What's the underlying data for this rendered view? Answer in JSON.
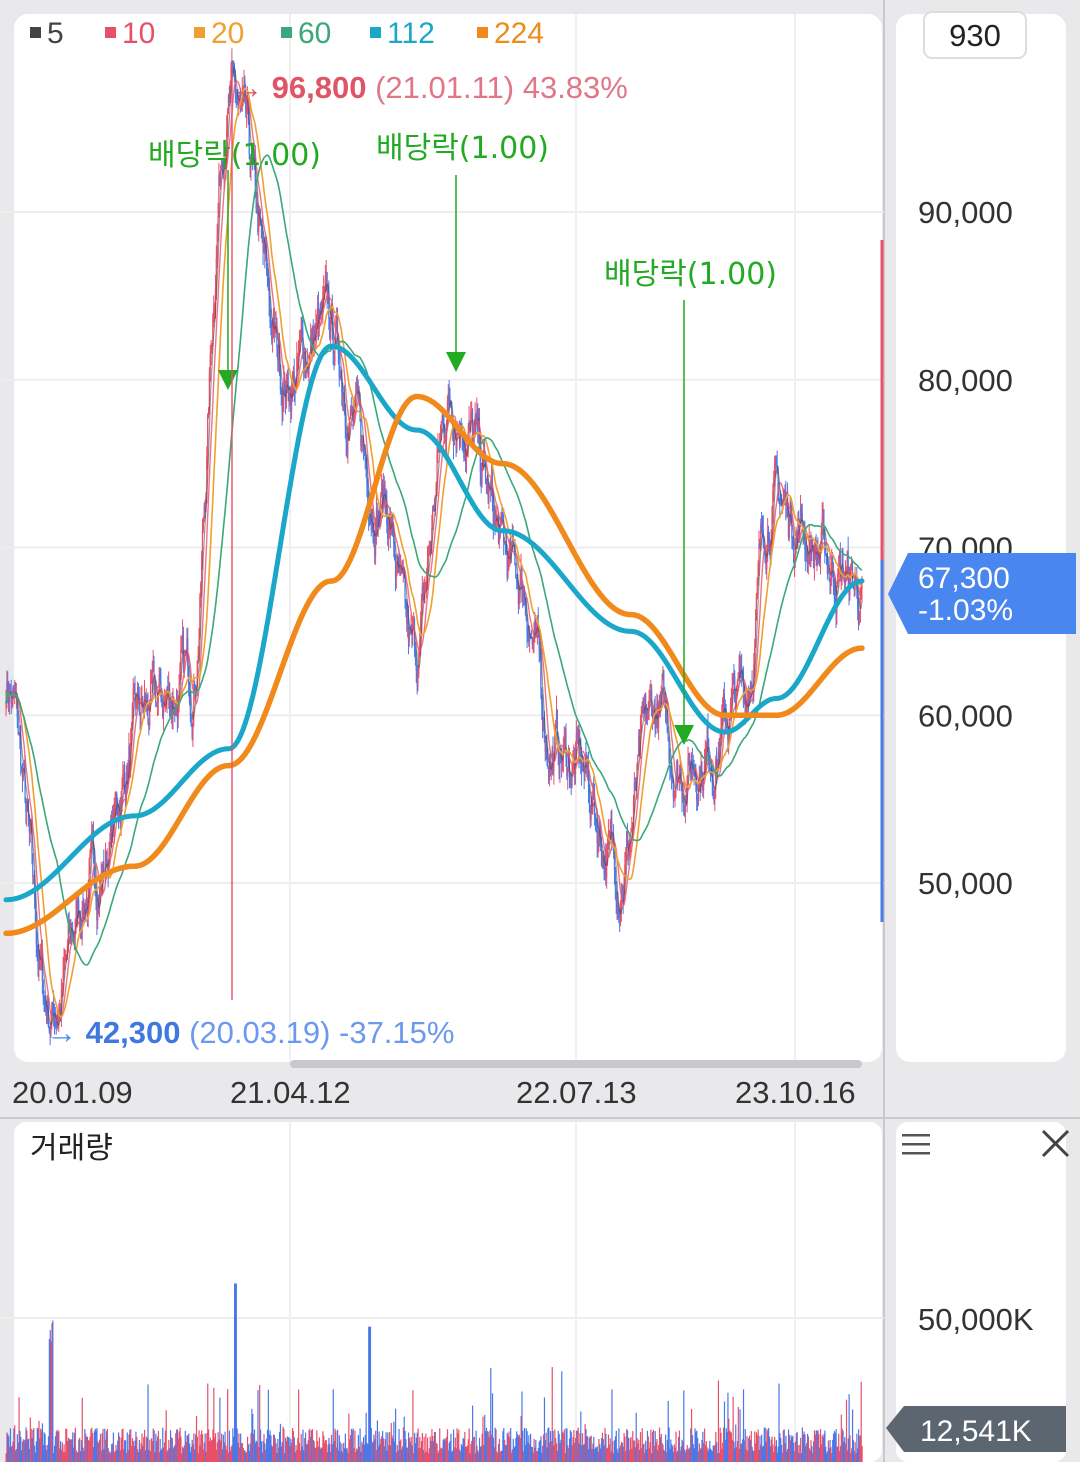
{
  "header": {
    "count_badge": "930"
  },
  "legend": [
    {
      "label": "5",
      "color": "#444444"
    },
    {
      "label": "10",
      "color": "#e8506a"
    },
    {
      "label": "20",
      "color": "#f0a030"
    },
    {
      "label": "60",
      "color": "#3aa87a"
    },
    {
      "label": "112",
      "color": "#1aa7c9"
    },
    {
      "label": "224",
      "color": "#f08a1c"
    }
  ],
  "annotations": {
    "high": {
      "arrow": "→",
      "value": "96,800",
      "detail": "(21.01.11) 43.83%"
    },
    "low": {
      "arrow": "→",
      "value": "42,300",
      "detail": "(20.03.19) -37.15%"
    },
    "dividends": [
      "배당락(1.00)",
      "배당락(1.00)",
      "배당락(1.00)"
    ]
  },
  "price_tag": {
    "price": "67,300",
    "change": "-1.03%"
  },
  "volume_panel": {
    "title": "거래량",
    "menu_icon": "hamburger-icon",
    "close_icon": "close-icon",
    "axis_label": "50,000K",
    "current_tag": "12,541K"
  },
  "colors": {
    "candle_down": "#4a78e8",
    "candle_up": "#e8506a",
    "dividend": "#22aa22",
    "price_tag": "#4a86f0"
  },
  "chart_data": {
    "type": "line",
    "y_ticks": [
      "90,000",
      "80,000",
      "70,000",
      "60,000",
      "50,000"
    ],
    "y_tick_values": [
      90000,
      80000,
      70000,
      60000,
      50000
    ],
    "ylim": [
      38000,
      100000
    ],
    "x_ticks": [
      "20.01.09",
      "21.04.12",
      "22.07.13",
      "23.10.16"
    ],
    "series": [
      {
        "name": "price",
        "x": [
          "20.01.09",
          "20.03.19",
          "20.06",
          "20.09",
          "20.11",
          "21.01.11",
          "21.04.12",
          "21.06",
          "21.09",
          "21.11",
          "22.01",
          "22.03",
          "22.05",
          "22.07.13",
          "22.09",
          "22.11",
          "23.01",
          "23.03",
          "23.05",
          "23.07",
          "23.10.16",
          "23.12",
          "24.02"
        ],
        "values": [
          62000,
          42300,
          50000,
          60000,
          62000,
          96800,
          80000,
          83000,
          73000,
          63000,
          79000,
          68000,
          58000,
          57000,
          51000,
          60000,
          57000,
          58000,
          61000,
          73000,
          72000,
          69000,
          67300
        ]
      },
      {
        "name": "112",
        "x": [
          "20.01.09",
          "20.06",
          "20.11",
          "21.04.12",
          "21.09",
          "22.01",
          "22.07.13",
          "23.01",
          "23.06",
          "24.02"
        ],
        "values": [
          49000,
          54000,
          58000,
          82000,
          77000,
          71000,
          65000,
          59000,
          61000,
          68000
        ]
      },
      {
        "name": "224",
        "x": [
          "20.01.09",
          "20.06",
          "20.11",
          "21.04.12",
          "21.09",
          "22.01",
          "22.07.13",
          "23.01",
          "23.06",
          "24.02"
        ],
        "values": [
          47000,
          51000,
          57000,
          68000,
          79000,
          75000,
          66000,
          60000,
          60000,
          64000
        ]
      }
    ],
    "volume_max_tick": "50,000K"
  }
}
